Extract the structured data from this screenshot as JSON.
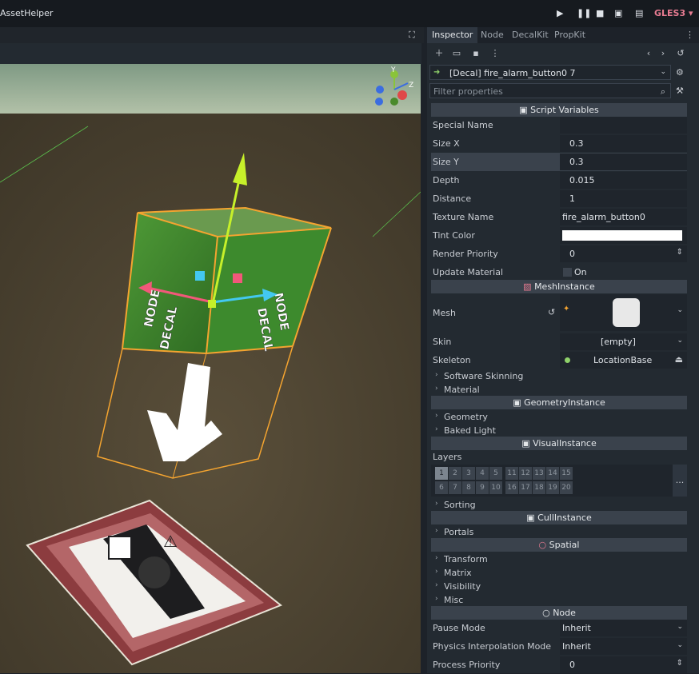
{
  "app": {
    "title": "AssetHelper",
    "renderer": "GLES3 ▾"
  },
  "inspector": {
    "tabs": [
      "Inspector",
      "Node",
      "DecalKit",
      "PropKit"
    ],
    "object": "[Decal] fire_alarm_button0 7",
    "filter_placeholder": "Filter properties",
    "sections": {
      "script": "Script Variables",
      "mesh": "MeshInstance",
      "geometry": "GeometryInstance",
      "visual": "VisualInstance",
      "cull": "CullInstance",
      "spatial": "Spatial",
      "node": "Node"
    },
    "script_rows": [
      {
        "name": "Special Name",
        "value": ""
      },
      {
        "name": "Size X",
        "value": "0.3"
      },
      {
        "name": "Size Y",
        "value": "0.3"
      },
      {
        "name": "Depth",
        "value": "0.015"
      },
      {
        "name": "Distance",
        "value": "1"
      },
      {
        "name": "Texture Name",
        "value": "fire_alarm_button0"
      },
      {
        "name": "Tint Color",
        "value": ""
      },
      {
        "name": "Render Priority",
        "value": "0"
      },
      {
        "name": "Update Material",
        "value": "On"
      }
    ],
    "mesh_rows": [
      {
        "name": "Mesh",
        "value": ""
      },
      {
        "name": "Skin",
        "value": "[empty]"
      },
      {
        "name": "Skeleton",
        "value": "LocationBase"
      }
    ],
    "mesh_subs": [
      "Software Skinning",
      "Material"
    ],
    "geometry_subs": [
      "Geometry",
      "Baked Light"
    ],
    "visual": {
      "label": "Layers",
      "row1": [
        "1",
        "2",
        "3",
        "4",
        "5",
        "11",
        "12",
        "13",
        "14",
        "15"
      ],
      "row2": [
        "6",
        "7",
        "8",
        "9",
        "10",
        "16",
        "17",
        "18",
        "19",
        "20"
      ],
      "more": "..."
    },
    "visual_subs": [
      "Sorting"
    ],
    "cull_subs": [
      "Portals"
    ],
    "spatial_subs": [
      "Transform",
      "Matrix",
      "Visibility",
      "Misc"
    ],
    "node_rows": [
      {
        "name": "Pause Mode",
        "value": "Inherit"
      },
      {
        "name": "Physics Interpolation Mode",
        "value": "Inherit"
      },
      {
        "name": "Process Priority",
        "value": "0"
      }
    ]
  },
  "viewport": {
    "gizmo": {
      "y": "Y",
      "z": "Z"
    },
    "decal_label_left": "NODE\nDECAL",
    "decal_label_right": "NODE\nDECAL"
  },
  "colors": {
    "accent_red": "#e77b91",
    "selection_orange": "#f4a430",
    "section_bg": "#3a424c"
  }
}
